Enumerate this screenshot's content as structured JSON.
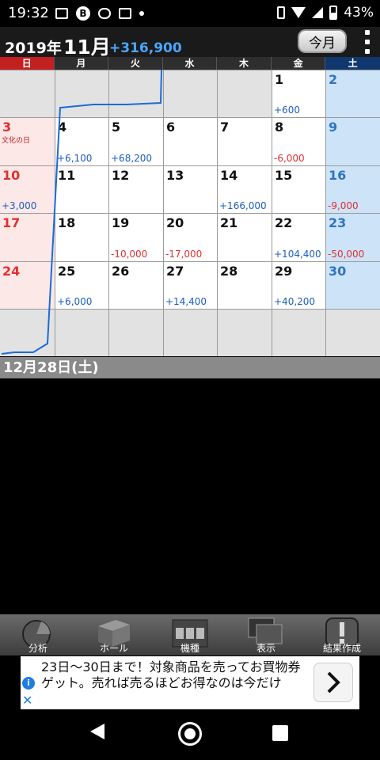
{
  "status": {
    "time": "19:32",
    "battery": "43%"
  },
  "header": {
    "year": "2019年",
    "month": "11月",
    "total": "+316,900",
    "today_label": "今月"
  },
  "weekdays": [
    "日",
    "月",
    "火",
    "水",
    "木",
    "金",
    "土"
  ],
  "calendar": {
    "rows": [
      [
        {
          "day": "",
          "amt": ""
        },
        {
          "day": "",
          "amt": ""
        },
        {
          "day": "",
          "amt": ""
        },
        {
          "day": "",
          "amt": ""
        },
        {
          "day": "",
          "amt": ""
        },
        {
          "day": "1",
          "amt": "+600"
        },
        {
          "day": "2",
          "amt": ""
        }
      ],
      [
        {
          "day": "3",
          "amt": "",
          "holiday": "文化の日"
        },
        {
          "day": "4",
          "amt": "+6,100"
        },
        {
          "day": "5",
          "amt": "+68,200"
        },
        {
          "day": "6",
          "amt": ""
        },
        {
          "day": "7",
          "amt": ""
        },
        {
          "day": "8",
          "amt": "-6,000"
        },
        {
          "day": "9",
          "amt": ""
        }
      ],
      [
        {
          "day": "10",
          "amt": "+3,000"
        },
        {
          "day": "11",
          "amt": ""
        },
        {
          "day": "12",
          "amt": ""
        },
        {
          "day": "13",
          "amt": ""
        },
        {
          "day": "14",
          "amt": "+166,000"
        },
        {
          "day": "15",
          "amt": ""
        },
        {
          "day": "16",
          "amt": "-9,000"
        }
      ],
      [
        {
          "day": "17",
          "amt": ""
        },
        {
          "day": "18",
          "amt": ""
        },
        {
          "day": "19",
          "amt": "-10,000"
        },
        {
          "day": "20",
          "amt": "-17,000"
        },
        {
          "day": "21",
          "amt": ""
        },
        {
          "day": "22",
          "amt": "+104,400"
        },
        {
          "day": "23",
          "amt": "-50,000"
        }
      ],
      [
        {
          "day": "24",
          "amt": ""
        },
        {
          "day": "25",
          "amt": "+6,000"
        },
        {
          "day": "26",
          "amt": ""
        },
        {
          "day": "27",
          "amt": "+14,400"
        },
        {
          "day": "28",
          "amt": ""
        },
        {
          "day": "29",
          "amt": "+40,200"
        },
        {
          "day": "30",
          "amt": ""
        }
      ],
      [
        {
          "day": "",
          "amt": ""
        },
        {
          "day": "",
          "amt": ""
        },
        {
          "day": "",
          "amt": ""
        },
        {
          "day": "",
          "amt": ""
        },
        {
          "day": "",
          "amt": ""
        },
        {
          "day": "",
          "amt": ""
        },
        {
          "day": "",
          "amt": ""
        }
      ]
    ]
  },
  "selected_date": "12月28日(土)",
  "toolbar": {
    "items": [
      {
        "label": "分析",
        "icon": "pie-chart-icon"
      },
      {
        "label": "ホール",
        "icon": "hall-building-icon"
      },
      {
        "label": "機種",
        "icon": "slot-machine-icon"
      },
      {
        "label": "表示",
        "icon": "display-window-icon"
      },
      {
        "label": "結果作成",
        "icon": "exclamation-icon"
      }
    ]
  },
  "ad": {
    "text": "23日〜30日まで！対象商品を売ってお買物券ゲット。売れば売るほどお得なのは今だけ"
  },
  "colors": {
    "positive": "#1c5fc0",
    "negative": "#e03030",
    "sunday": "#c32020",
    "saturday": "#10386e"
  }
}
